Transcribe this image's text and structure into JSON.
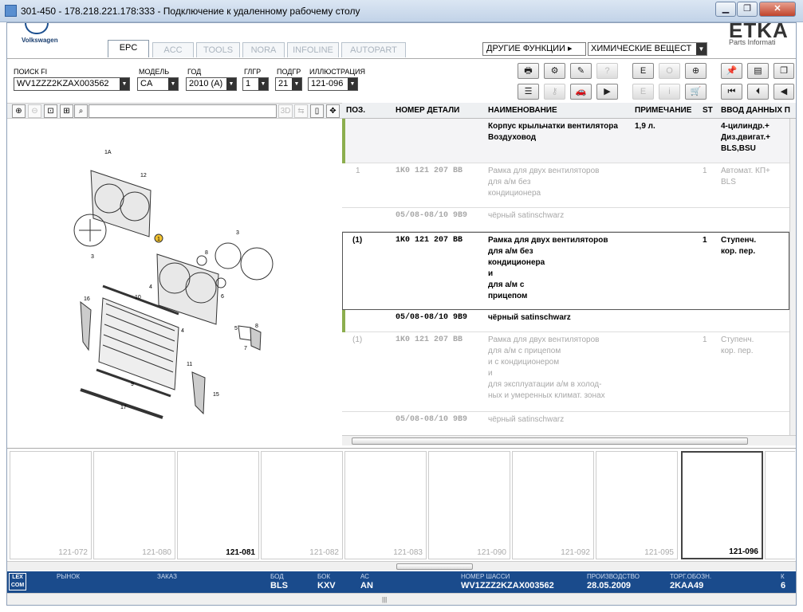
{
  "window": {
    "title": "301-450 - 178.218.221.178:333 - Подключение к удаленному рабочему столу",
    "min": "▁",
    "max": "❐",
    "close": "✕"
  },
  "brand": {
    "vw": "Volkswagen",
    "etka": "ETKA",
    "etka_sub": "Parts Informati"
  },
  "tabs": [
    "EPC",
    "ACC",
    "TOOLS",
    "NORA",
    "INFOLINE",
    "AUTOPART"
  ],
  "other_functions": "ДРУГИЕ ФУНКЦИИ ▸",
  "chem_select": "ХИМИЧЕСКИЕ ВЕЩЕСТ",
  "fields": {
    "vin": {
      "label": "ПОИСК FI",
      "value": "WV1ZZZ2KZAX003562"
    },
    "model": {
      "label": "МОДЕЛЬ",
      "value": "CA"
    },
    "year": {
      "label": "ГОД",
      "value": "2010 (A)"
    },
    "mgroup": {
      "label": "ГЛГР",
      "value": "1"
    },
    "sgroup": {
      "label": "ПОДГР",
      "value": "21"
    },
    "illus": {
      "label": "ИЛЛЮСТРАЦИЯ",
      "value": "121-096"
    }
  },
  "table": {
    "headers": {
      "pos": "ПОЗ.",
      "partno": "НОМЕР ДЕТАЛИ",
      "name": "НАИМЕНОВАНИЕ",
      "note": "ПРИМЕЧАНИЕ",
      "st": "ST",
      "entry": "ВВОД ДАННЫХ П"
    },
    "rows": [
      {
        "pos": "",
        "partno": "",
        "name": "Корпус крыльчатки вентилятора\nВоздуховод",
        "note": "1,9 л.",
        "st": "",
        "entry": "4-цилиндр.+\nДиз.двигат.+\nBLS,BSU"
      },
      {
        "pos": "1",
        "partno": "1K0 121 207 BB",
        "name": "Рамка для двух вентиляторов\nдля а/м без\nкондиционера",
        "note": "",
        "st": "1",
        "entry": "Автомат. КП+\nBLS"
      },
      {
        "pos": "",
        "partno": "05/08-08/10 9B9",
        "name": "чёрный satinschwarz",
        "note": "",
        "st": "",
        "entry": ""
      },
      {
        "pos": "(1)",
        "partno": "1K0 121 207 BB",
        "name": "Рамка для двух вентиляторов\nдля а/м без\nкондиционера\nи\nдля а/м с\nприцепом",
        "note": "",
        "st": "1",
        "entry": "Ступенч.\nкор. пер."
      },
      {
        "pos": "",
        "partno": "05/08-08/10 9B9",
        "name": "чёрный satinschwarz",
        "note": "",
        "st": "",
        "entry": ""
      },
      {
        "pos": "(1)",
        "partno": "1K0 121 207 BB",
        "name": "Рамка для двух вентиляторов\nдля а/м с прицепом\nи с кондиционером\nи\nдля эксплуатации а/м в холод-\nных и умеренных климат. зонах",
        "note": "",
        "st": "1",
        "entry": "Ступенч.\nкор. пер."
      },
      {
        "pos": "",
        "partno": "05/08-08/10 9B9",
        "name": "чёрный satinschwarz",
        "note": "",
        "st": "",
        "entry": ""
      }
    ]
  },
  "thumbnails": [
    "121-072",
    "121-080",
    "121-081",
    "121-082",
    "121-083",
    "121-090",
    "121-092",
    "121-095",
    "121-096"
  ],
  "status": {
    "market": {
      "label": "РЫНОК",
      "value": ""
    },
    "order": {
      "label": "ЗАКАЗ",
      "value": ""
    },
    "bod": {
      "label": "БОД",
      "value": "BLS"
    },
    "bok": {
      "label": "БОК",
      "value": "KXV"
    },
    "as": {
      "label": "АС",
      "value": "AN"
    },
    "chassis": {
      "label": "НОМЕР ШАССИ",
      "value": "WV1ZZZ2KZAX003562"
    },
    "prod": {
      "label": "ПРОИЗВОДСТВО",
      "value": "28.05.2009"
    },
    "trade": {
      "label": "ТОРГ.ОБОЗН.",
      "value": "2KAA49"
    },
    "k": {
      "label": "К",
      "value": "6"
    }
  },
  "lexcom": "LEX\nCOM",
  "diagram_labels": [
    "1A",
    "12",
    "1",
    "3",
    "8",
    "3",
    "4",
    "6",
    "10",
    "16",
    "4",
    "5",
    "7",
    "8",
    "11",
    "9",
    "15",
    "17"
  ],
  "bottom_grip": "|||"
}
